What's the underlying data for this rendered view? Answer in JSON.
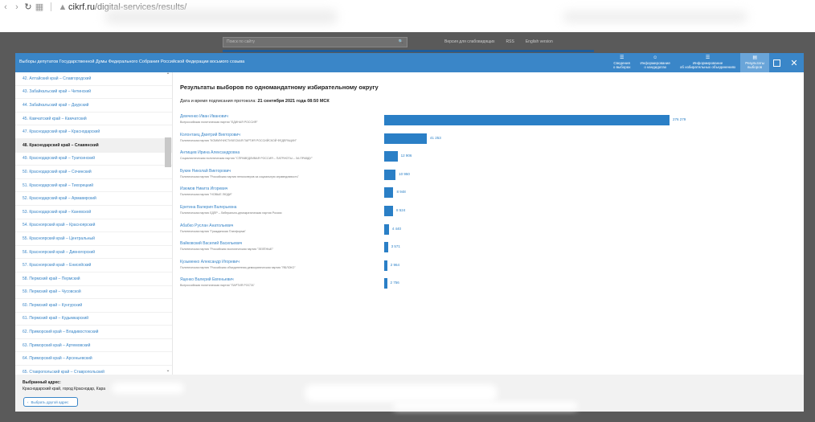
{
  "browser": {
    "url_domain": "cikrf.ru",
    "url_path": "/digital-services/results/"
  },
  "site": {
    "search_placeholder": "Поиск по сайту",
    "links": [
      "Версия для слабовидящих",
      "RSS",
      "English version"
    ]
  },
  "modal": {
    "title": "Выборы депутатов Государственной Думы Федерального Собрания Российской Федерации восьмого созыва",
    "tabs": [
      {
        "line1": "Сведения",
        "line2": "о выборах",
        "icon": "document-icon",
        "active": false
      },
      {
        "line1": "Информирование",
        "line2": "о кандидатах",
        "icon": "people-icon",
        "active": false
      },
      {
        "line1": "Информирование",
        "line2": "об избирательных объединениях",
        "icon": "group-icon",
        "active": false
      },
      {
        "line1": "Результаты",
        "line2": "выборов",
        "icon": "results-icon",
        "active": true
      }
    ]
  },
  "sidebar": {
    "items": [
      "42. Алтайский край – Славгородский",
      "43. Забайкальский край – Читинский",
      "44. Забайкальский край – Даурский",
      "45. Камчатский край – Камчатский",
      "47. Краснодарский край – Краснодарский",
      "48. Краснодарский край – Славянский",
      "49. Краснодарский край – Туапсинский",
      "50. Краснодарский край – Сочинский",
      "51. Краснодарский край – Тихорецкий",
      "52. Краснодарский край – Армавирский",
      "53. Краснодарский край – Каневской",
      "54. Красноярский край – Красноярский",
      "55. Красноярский край – Центральный",
      "56. Красноярский край – Дивногорский",
      "57. Красноярский край – Енисейский",
      "58. Пермский край – Пермский",
      "59. Пермский край – Чусовской",
      "60. Пермский край – Кунгурский",
      "61. Пермский край – Кудымкарский",
      "62. Приморский край – Владивостокский",
      "63. Приморский край – Артемовский",
      "64. Приморский край – Арсеньевский",
      "65. Ставропольский край – Ставропольский"
    ],
    "active_index": 5
  },
  "footer": {
    "selected_label": "Выбранный адрес:",
    "address": "Краснодарский край, город Краснодар, Кара",
    "change_button": "Выбрать другой адрес"
  },
  "results": {
    "title": "Результаты выборов по одномандатному избирательному округу",
    "date_label": "Дата и время подписания протокола:",
    "date_value": "21 сентября 2021 года 08:50 МСК",
    "max_votes": 276279,
    "candidates": [
      {
        "name": "Демченко Иван Иванович",
        "party": "Всероссийская политическая партия \"ЕДИНАЯ РОССИЯ\"",
        "votes": 276279,
        "votes_label": "276 279"
      },
      {
        "name": "Колонтаец Дмитрий Викторович",
        "party": "Политическая партия \"КОММУНИСТИЧЕСКАЯ ПАРТИЯ РОССИЙСКОЙ ФЕДЕРАЦИИ\"",
        "votes": 41253,
        "votes_label": "41 253"
      },
      {
        "name": "Антищев Ирина Александровна",
        "party": "Социалистическая политическая партия \"СПРАВЕДЛИВАЯ РОССИЯ – ПАТРИОТЫ – ЗА ПРАВДУ\"",
        "votes": 12906,
        "votes_label": "12 906"
      },
      {
        "name": "Букин Николай Викторович",
        "party": "Политическая партия \"Российская партия пенсионеров за социальную справедливость\"",
        "votes": 10950,
        "votes_label": "10 950"
      },
      {
        "name": "Изюмов Никита Игоревич",
        "party": "Политическая партия \"НОВЫЕ ЛЮДИ\"",
        "votes": 8948,
        "votes_label": "8 948"
      },
      {
        "name": "Еретина Валерия Валерьевна",
        "party": "Политическая партия ЛДПР – Либерально-демократическая партия России",
        "votes": 8524,
        "votes_label": "8 524"
      },
      {
        "name": "Абабко Руслан Анатольевич",
        "party": "Политическая партия \"Гражданская Платформа\"",
        "votes": 4440,
        "votes_label": "4 440"
      },
      {
        "name": "Вайковский Василий Васильевич",
        "party": "Политическая партия \"Российская экологическая партия \"ЗЕЛЁНЫЕ\"",
        "votes": 3571,
        "votes_label": "3 571"
      },
      {
        "name": "Кузьменко Александр Игоревич",
        "party": "Политическая партия \"Российская объединенная демократическая партия \"ЯБЛОКО\"",
        "votes": 2964,
        "votes_label": "2 964"
      },
      {
        "name": "Яценко Валерий Евгеньевич",
        "party": "Всероссийская политическая партия \"ПАРТИЯ РОСТА\"",
        "votes": 2756,
        "votes_label": "2 756"
      }
    ]
  }
}
